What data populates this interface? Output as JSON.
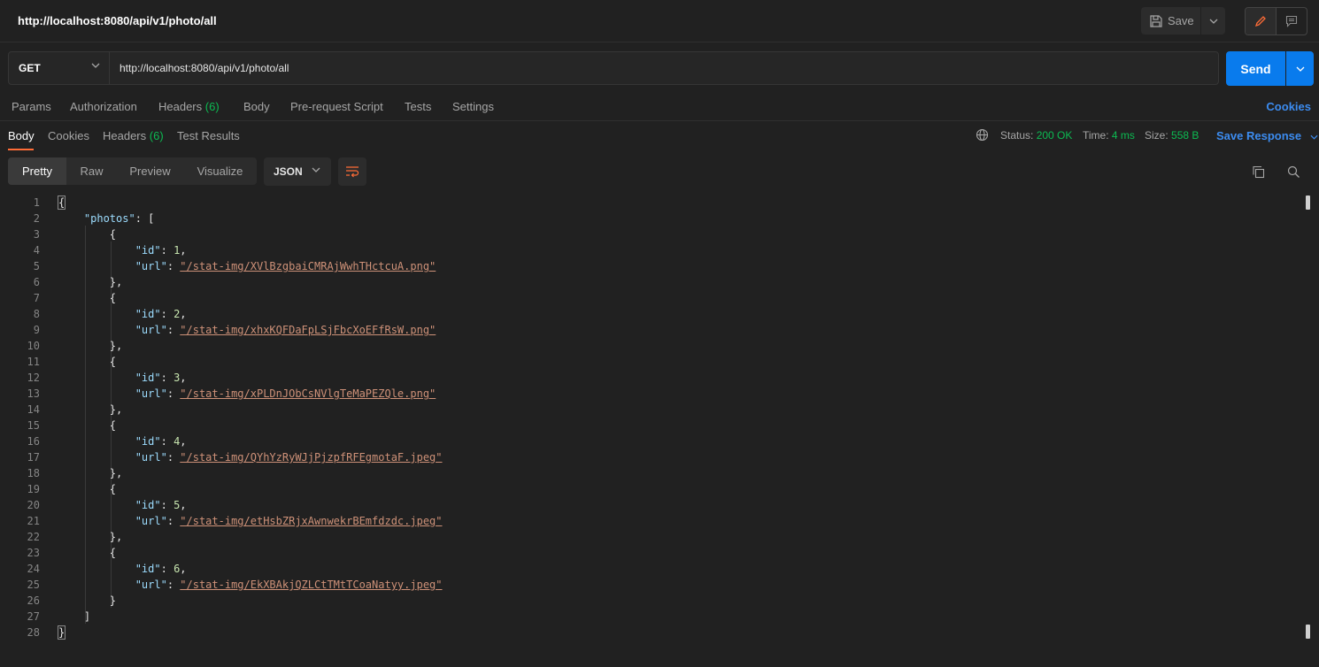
{
  "header": {
    "request_title": "http://localhost:8080/api/v1/photo/all",
    "save_label": "Save"
  },
  "request": {
    "method": "GET",
    "url": "http://localhost:8080/api/v1/photo/all",
    "send_label": "Send"
  },
  "request_tabs": {
    "params": "Params",
    "authorization": "Authorization",
    "headers": "Headers",
    "headers_count": "(6)",
    "body": "Body",
    "prerequest": "Pre-request Script",
    "tests": "Tests",
    "settings": "Settings",
    "cookies": "Cookies"
  },
  "response_tabs": {
    "body": "Body",
    "cookies": "Cookies",
    "headers": "Headers",
    "headers_count": "(6)",
    "test_results": "Test Results"
  },
  "response_meta": {
    "status_label": "Status:",
    "status_value": "200 OK",
    "time_label": "Time:",
    "time_value": "4 ms",
    "size_label": "Size:",
    "size_value": "558 B",
    "save_response": "Save Response"
  },
  "body_toolbar": {
    "views": [
      "Pretty",
      "Raw",
      "Preview",
      "Visualize"
    ],
    "format": "JSON"
  },
  "icons": {
    "save": "save-icon",
    "edit": "pencil-icon",
    "comments": "comment-icon",
    "globe": "globe-icon",
    "wrap": "wrap-lines-icon",
    "copy": "copy-icon",
    "search": "search-icon"
  },
  "colors": {
    "accent_orange": "#ff6c37",
    "send_blue": "#097bed",
    "status_green": "#0cbb52",
    "link_blue": "#3c8cf0"
  },
  "response_body": {
    "line_numbers": [
      "1",
      "2",
      "3",
      "4",
      "5",
      "6",
      "7",
      "8",
      "9",
      "10",
      "11",
      "12",
      "13",
      "14",
      "15",
      "16",
      "17",
      "18",
      "19",
      "20",
      "21",
      "22",
      "23",
      "24",
      "25",
      "26",
      "27",
      "28"
    ],
    "photos": [
      {
        "id": "1",
        "url": "\"/stat-img/XVlBzgbaiCMRAjWwhTHctcuA.png\""
      },
      {
        "id": "2",
        "url": "\"/stat-img/xhxKQFDaFpLSjFbcXoEFfRsW.png\""
      },
      {
        "id": "3",
        "url": "\"/stat-img/xPLDnJObCsNVlgTeMaPEZQle.png\""
      },
      {
        "id": "4",
        "url": "\"/stat-img/QYhYzRyWJjPjzpfRFEgmotaF.jpeg\""
      },
      {
        "id": "5",
        "url": "\"/stat-img/etHsbZRjxAwnwekrBEmfdzdc.jpeg\""
      },
      {
        "id": "6",
        "url": "\"/stat-img/EkXBAkjQZLCtTMtTCoaNatyy.jpeg\""
      }
    ]
  }
}
